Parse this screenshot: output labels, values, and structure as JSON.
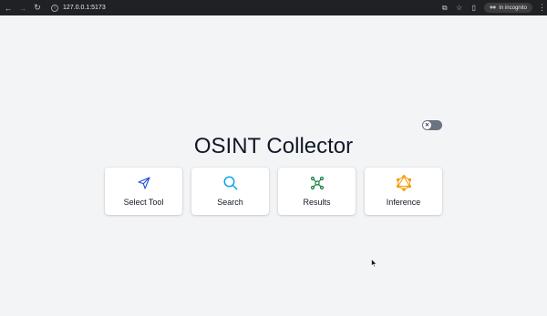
{
  "browser": {
    "url": "127.0.0.1:5173",
    "incognito_label": "In incognito",
    "icons": [
      "back-icon",
      "forward-icon",
      "reload-icon",
      "info-icon",
      "translate-icon",
      "star-icon",
      "sidepanel-icon",
      "incognito-icon",
      "kebab-menu-icon"
    ]
  },
  "toggle": {
    "state": "off"
  },
  "page": {
    "title": "OSINT Collector"
  },
  "cards": [
    {
      "label": "Select Tool",
      "icon": "send-icon",
      "color": "#1d4ed8"
    },
    {
      "label": "Search",
      "icon": "search-icon",
      "color": "#0ea5e9"
    },
    {
      "label": "Results",
      "icon": "graph-nodes-icon",
      "color": "#15803d"
    },
    {
      "label": "Inference",
      "icon": "graphql-icon",
      "color": "#f59e0b"
    }
  ]
}
